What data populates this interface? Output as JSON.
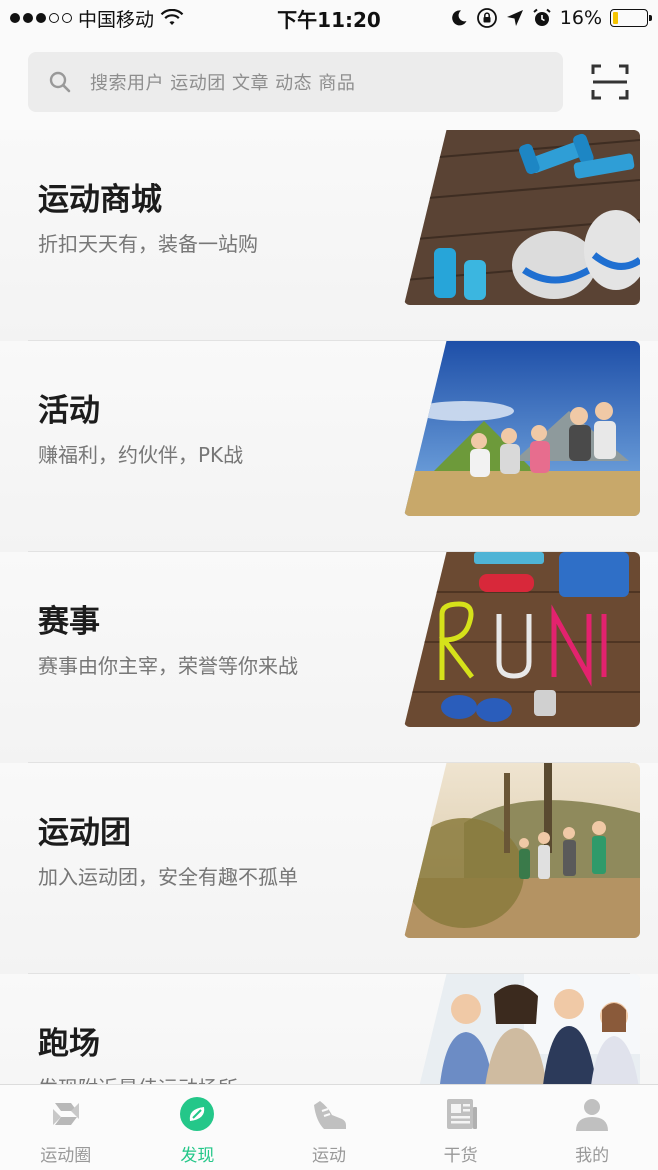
{
  "status_bar": {
    "carrier": "中国移动",
    "time": "下午11:20",
    "battery": "16%",
    "battery_level": 0.16,
    "signal_bars": 3,
    "signal_total": 5
  },
  "search": {
    "placeholder": "搜索用户 运动团 文章 动态 商品",
    "scan_icon": "scan-icon"
  },
  "cards": [
    {
      "title": "运动商城",
      "subtitle": "折扣天天有，装备一站购",
      "image": "sports-gear-photo"
    },
    {
      "title": "活动",
      "subtitle": "赚福利，约伙伴，PK战",
      "image": "camping-friends-photo"
    },
    {
      "title": "赛事",
      "subtitle": "赛事由你主宰，荣誉等你来战",
      "image": "run-shoelaces-photo"
    },
    {
      "title": "运动团",
      "subtitle": "加入运动团，安全有趣不孤单",
      "image": "group-hiking-photo"
    },
    {
      "title": "跑场",
      "subtitle": "发现附近最佳运动场所",
      "image": "business-people-photo"
    }
  ],
  "tabs": [
    {
      "label": "运动圈",
      "icon": "sports-circle-icon",
      "active": false
    },
    {
      "label": "发现",
      "icon": "discover-icon",
      "active": true
    },
    {
      "label": "运动",
      "icon": "shoe-icon",
      "active": false
    },
    {
      "label": "干货",
      "icon": "article-icon",
      "active": false
    },
    {
      "label": "我的",
      "icon": "profile-icon",
      "active": false
    }
  ],
  "colors": {
    "accent": "#24c789",
    "tab_inactive": "#999999",
    "battery": "#f5c400"
  }
}
